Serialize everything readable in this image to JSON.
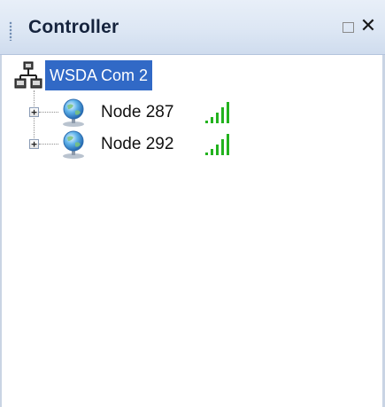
{
  "panel": {
    "title": "Controller",
    "restore_icon": "restore-window-icon",
    "close_label": "✕",
    "close_icon": "close-icon"
  },
  "tree": {
    "root": {
      "label": "WSDA Com 2",
      "icon": "network-icon",
      "selected": true,
      "selection_color": "#3169c6"
    },
    "nodes": [
      {
        "label": "Node 287",
        "icon": "globe-node-icon",
        "expander": "+",
        "signal_icon": "signal-strength-icon",
        "signal_bars_lit": 5,
        "signal_bars_total": 5
      },
      {
        "label": "Node 292",
        "icon": "globe-node-icon",
        "expander": "+",
        "signal_icon": "signal-strength-icon",
        "signal_bars_lit": 5,
        "signal_bars_total": 5
      }
    ]
  },
  "colors": {
    "titlebar": "#dde7f4",
    "signal_green": "#22b21e",
    "selection": "#3169c6"
  }
}
